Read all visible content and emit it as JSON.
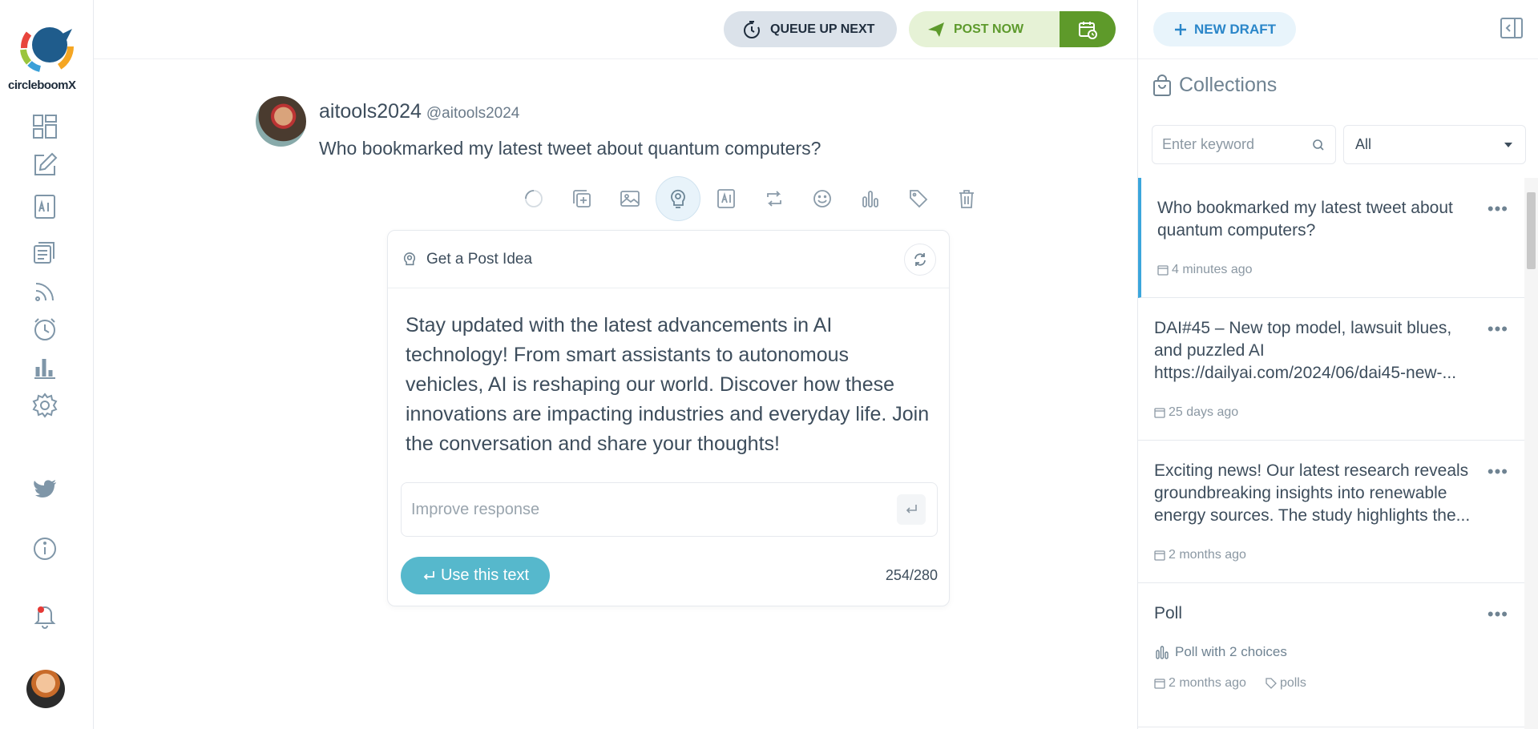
{
  "brand": {
    "name": "circleboomX"
  },
  "sidebar": {
    "icons": [
      "dashboard-icon",
      "compose-icon",
      "ai-icon",
      "posts-icon",
      "rss-icon",
      "scheduler-icon",
      "stats-icon",
      "settings-icon",
      "twitter-icon",
      "info-icon",
      "notification-bell-icon"
    ]
  },
  "topbar": {
    "queue_label": "QUEUE UP NEXT",
    "post_label": "POST NOW"
  },
  "post": {
    "username": "aitools2024",
    "handle": "@aitools2024",
    "text": "Who bookmarked my latest tweet about quantum computers?"
  },
  "idea": {
    "title": "Get a Post Idea",
    "body": "Stay updated with the latest advancements in AI technology! From smart assistants to autonomous vehicles, AI is reshaping our world. Discover how these innovations are impacting industries and everyday life. Join the conversation and share your thoughts!",
    "improve_placeholder": "Improve response",
    "use_label": "Use this text",
    "count": "254/280"
  },
  "right": {
    "new_draft_label": "NEW DRAFT",
    "collections_title": "Collections",
    "search_placeholder": "Enter keyword",
    "filter_value": "All",
    "items": [
      {
        "title": "Who bookmarked my latest tweet about quantum computers?",
        "time": "4 minutes ago"
      },
      {
        "title": "DAI#45 – New top model, lawsuit blues, and puzzled AI https://dailyai.com/2024/06/dai45-new-...",
        "time": "25 days ago"
      },
      {
        "title": "Exciting news! Our latest research reveals groundbreaking insights into renewable energy sources. The study highlights the...",
        "time": "2 months ago"
      },
      {
        "title": "Poll",
        "poll": "Poll with 2 choices",
        "time": "2 months ago",
        "tag": "polls"
      }
    ]
  },
  "colors": {
    "accent": "#56b8cc",
    "post_green": "#5e9a2a",
    "link_blue": "#2a86c9"
  }
}
